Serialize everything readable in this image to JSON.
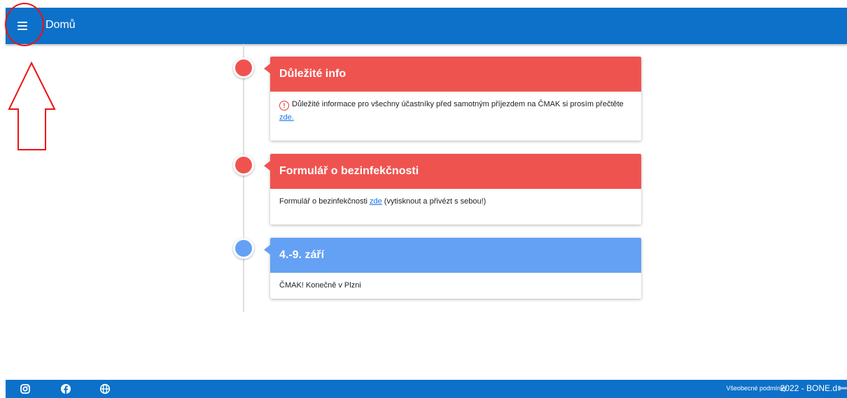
{
  "header": {
    "title": "Domů"
  },
  "timeline": [
    {
      "title": "Důležité info",
      "color": "#ef5350",
      "text_before": "Důležité informace pro všechny účastníky před samotným příjezdem na ČMAK si prosím přečtěte ",
      "link": "zde.",
      "text_after": "",
      "icon": "warning-circle-icon"
    },
    {
      "title": "Formulář o bezinfekčnosti",
      "color": "#ef5350",
      "text_before": "Formulář o bezinfekčnosti ",
      "link": "zde",
      "text_after": " (vytisknout a přivézt s sebou!)"
    },
    {
      "title": "4.-9. září",
      "color": "#64a1f4",
      "text_before": "ČMAK! Konečně v Plzni",
      "link": "",
      "text_after": ""
    }
  ],
  "footer": {
    "icons": [
      "instagram-icon",
      "facebook-icon",
      "globe-icon"
    ],
    "terms_link": "Všeobecné podmínky",
    "copyright": "2022 - BONE.d"
  },
  "colors": {
    "primary": "#0d71c9",
    "alert": "#ef5350",
    "info": "#64a1f4",
    "annotation": "#e11111"
  }
}
